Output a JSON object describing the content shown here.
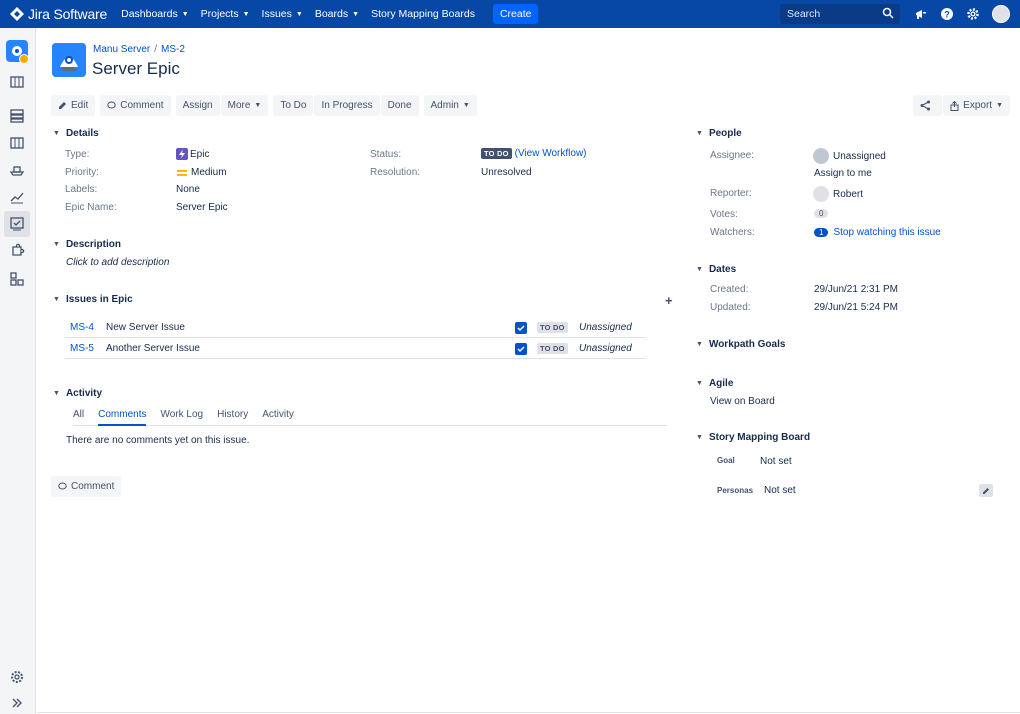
{
  "topnav": {
    "logo": "Jira Software",
    "menu": [
      {
        "label": "Dashboards",
        "has_chevron": true
      },
      {
        "label": "Projects",
        "has_chevron": true
      },
      {
        "label": "Issues",
        "has_chevron": true
      },
      {
        "label": "Boards",
        "has_chevron": true
      },
      {
        "label": "Story Mapping Boards",
        "has_chevron": false
      }
    ],
    "create_label": "Create",
    "search_placeholder": "Search",
    "icons": [
      "announcement-icon",
      "help-icon",
      "settings-icon",
      "user-avatar"
    ]
  },
  "sidebar": {
    "icons": [
      "project-avatar",
      "backlog-icon",
      "releases-icon",
      "board-icon",
      "ship-icon",
      "reports-icon",
      "issues-icon",
      "addons-icon",
      "components-icon",
      "settings-icon",
      "expand-icon"
    ]
  },
  "breadcrumb": {
    "project": "Manu Server",
    "separator": "/",
    "issue_key": "MS-2"
  },
  "issue": {
    "title": "Server Epic"
  },
  "toolbar": {
    "edit": "Edit",
    "comment": "Comment",
    "assign": "Assign",
    "more": "More",
    "todo": "To Do",
    "in_progress": "In Progress",
    "done": "Done",
    "admin": "Admin",
    "export": "Export"
  },
  "details": {
    "heading": "Details",
    "type_label": "Type:",
    "type_value": "Epic",
    "priority_label": "Priority:",
    "priority_value": "Medium",
    "labels_label": "Labels:",
    "labels_value": "None",
    "epic_name_label": "Epic Name:",
    "epic_name_value": "Server Epic",
    "status_label": "Status:",
    "status_value": "TO DO",
    "view_workflow": "(View Workflow)",
    "resolution_label": "Resolution:",
    "resolution_value": "Unresolved"
  },
  "description": {
    "heading": "Description",
    "placeholder": "Click to add description"
  },
  "issues_in_epic": {
    "heading": "Issues in Epic",
    "rows": [
      {
        "key": "MS-4",
        "summary": "New Server Issue",
        "status": "TO DO",
        "assignee": "Unassigned"
      },
      {
        "key": "MS-5",
        "summary": "Another Server Issue",
        "status": "TO DO",
        "assignee": "Unassigned"
      }
    ]
  },
  "activity": {
    "heading": "Activity",
    "tabs": [
      "All",
      "Comments",
      "Work Log",
      "History",
      "Activity"
    ],
    "active_tab": "Comments",
    "empty_message": "There are no comments yet on this issue.",
    "comment_button": "Comment"
  },
  "people": {
    "heading": "People",
    "assignee_label": "Assignee:",
    "assignee_value": "Unassigned",
    "assign_to_me": "Assign to me",
    "reporter_label": "Reporter:",
    "reporter_value": "Robert",
    "votes_label": "Votes:",
    "votes_value": "0",
    "watchers_label": "Watchers:",
    "watchers_count": "1",
    "stop_watching": "Stop watching this issue"
  },
  "dates": {
    "heading": "Dates",
    "created_label": "Created:",
    "created_value": "29/Jun/21 2:31 PM",
    "updated_label": "Updated:",
    "updated_value": "29/Jun/21 5:24 PM"
  },
  "workpath": {
    "heading": "Workpath Goals"
  },
  "agile": {
    "heading": "Agile",
    "view_on_board": "View on Board"
  },
  "story_mapping": {
    "heading": "Story Mapping Board",
    "goal_label": "Goal",
    "goal_value": "Not set",
    "personas_label": "Personas",
    "personas_value": "Not set"
  },
  "colors": {
    "nav": "#0747a6",
    "link": "#0052cc",
    "create": "#0065ff",
    "text": "#172b4d"
  }
}
